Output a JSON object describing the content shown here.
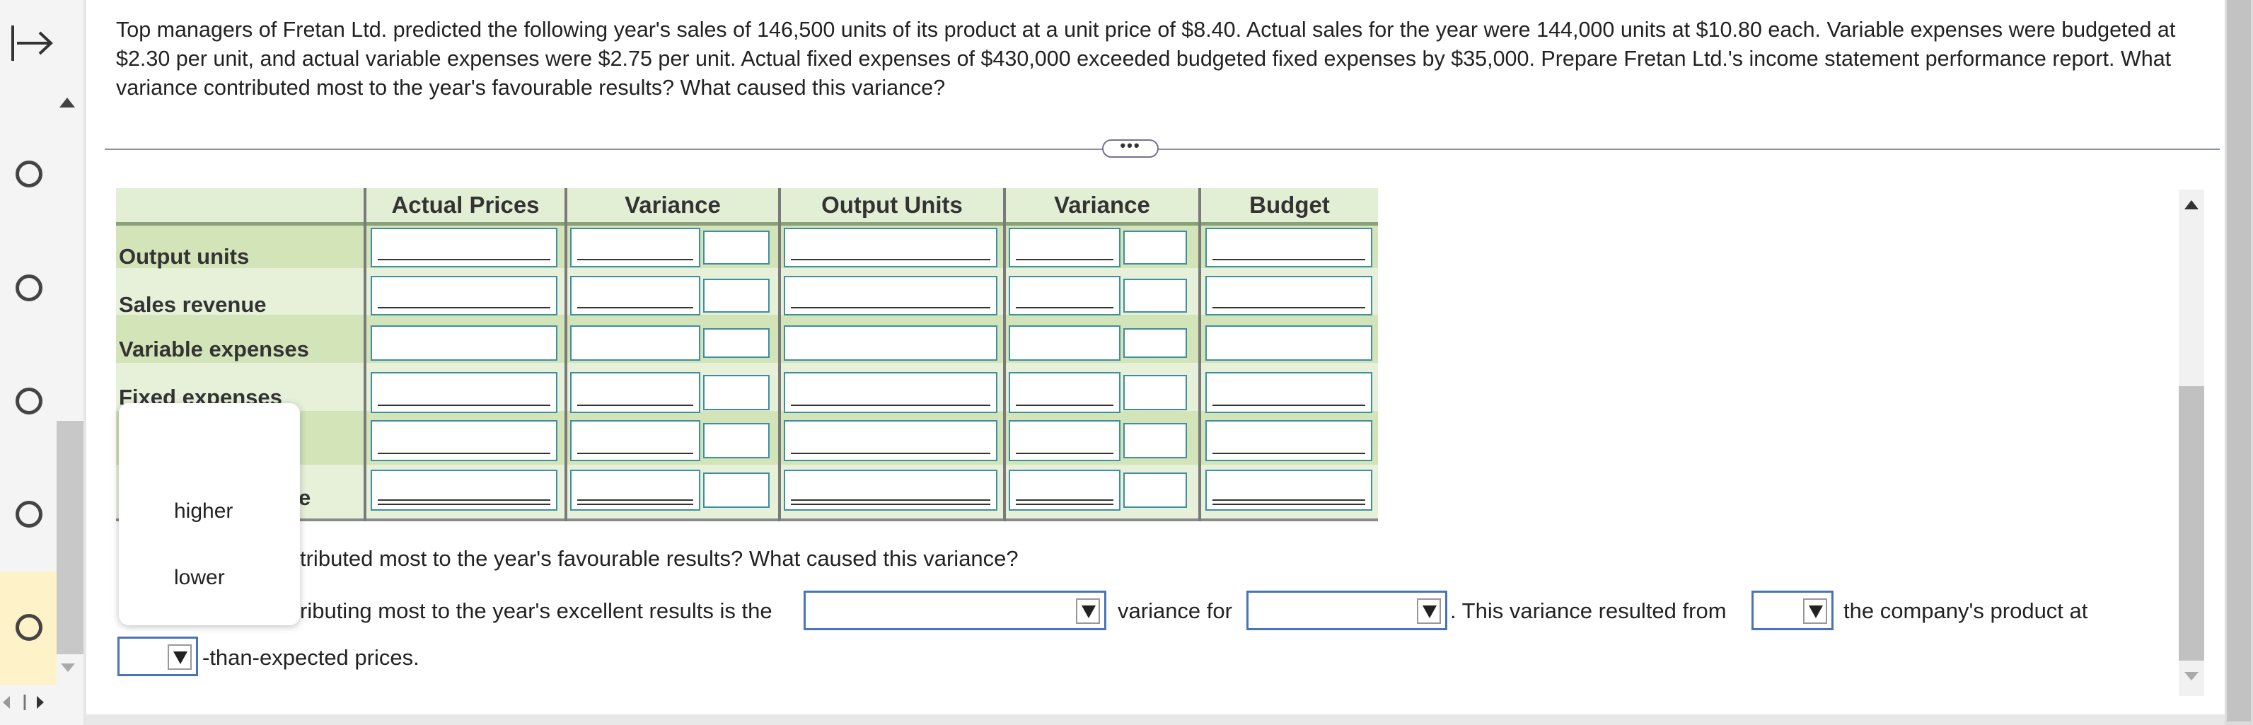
{
  "question": {
    "text": "Top managers of Fretan Ltd. predicted the following year's sales of 146,500 units of its product at a unit price of $8.40. Actual sales for the year were 144,000 units at $10.80 each. Variable expenses were budgeted at $2.30 per unit, and actual variable expenses were $2.75 per unit. Actual fixed expenses of $430,000 exceeded budgeted fixed expenses by $35,000. Prepare Fretan Ltd.'s income statement performance report. What variance contributed most to the year's favourable results? What caused this variance?"
  },
  "divider": {
    "handle_label": "•••"
  },
  "table": {
    "headers": [
      "Actual Prices",
      "Variance",
      "Output Units",
      "Variance",
      "Budget"
    ],
    "rows": [
      {
        "label": "Output units"
      },
      {
        "label": "Sales revenue"
      },
      {
        "label": "Variable expenses"
      },
      {
        "label": "Fixed expenses"
      },
      {
        "label": ""
      },
      {
        "label": "e"
      }
    ]
  },
  "dropdown_popup": {
    "options": [
      "higher",
      "lower"
    ]
  },
  "followup": {
    "question_visible": "tributed most to the year's favourable results? What caused this variance?",
    "sentence_part1": "ributing most to the year's excellent results is the",
    "sentence_part2": "variance for",
    "sentence_part3": ". This variance resulted from",
    "sentence_part4": "the company's product at",
    "sentence_part5": "-than-expected prices.",
    "select1_value": "",
    "select2_value": "",
    "select3_value": "",
    "select4_value": ""
  },
  "colors": {
    "header_bg": "#e3efd4",
    "label_col_bg": "#d3e4b8",
    "cell_border": "#3d8fa2",
    "select_border": "#4a73b8",
    "active_rail": "#fdf2c8"
  },
  "icons": {
    "rail_expand": "expand-panel-icon",
    "question_status": "radio-circle-icon"
  }
}
